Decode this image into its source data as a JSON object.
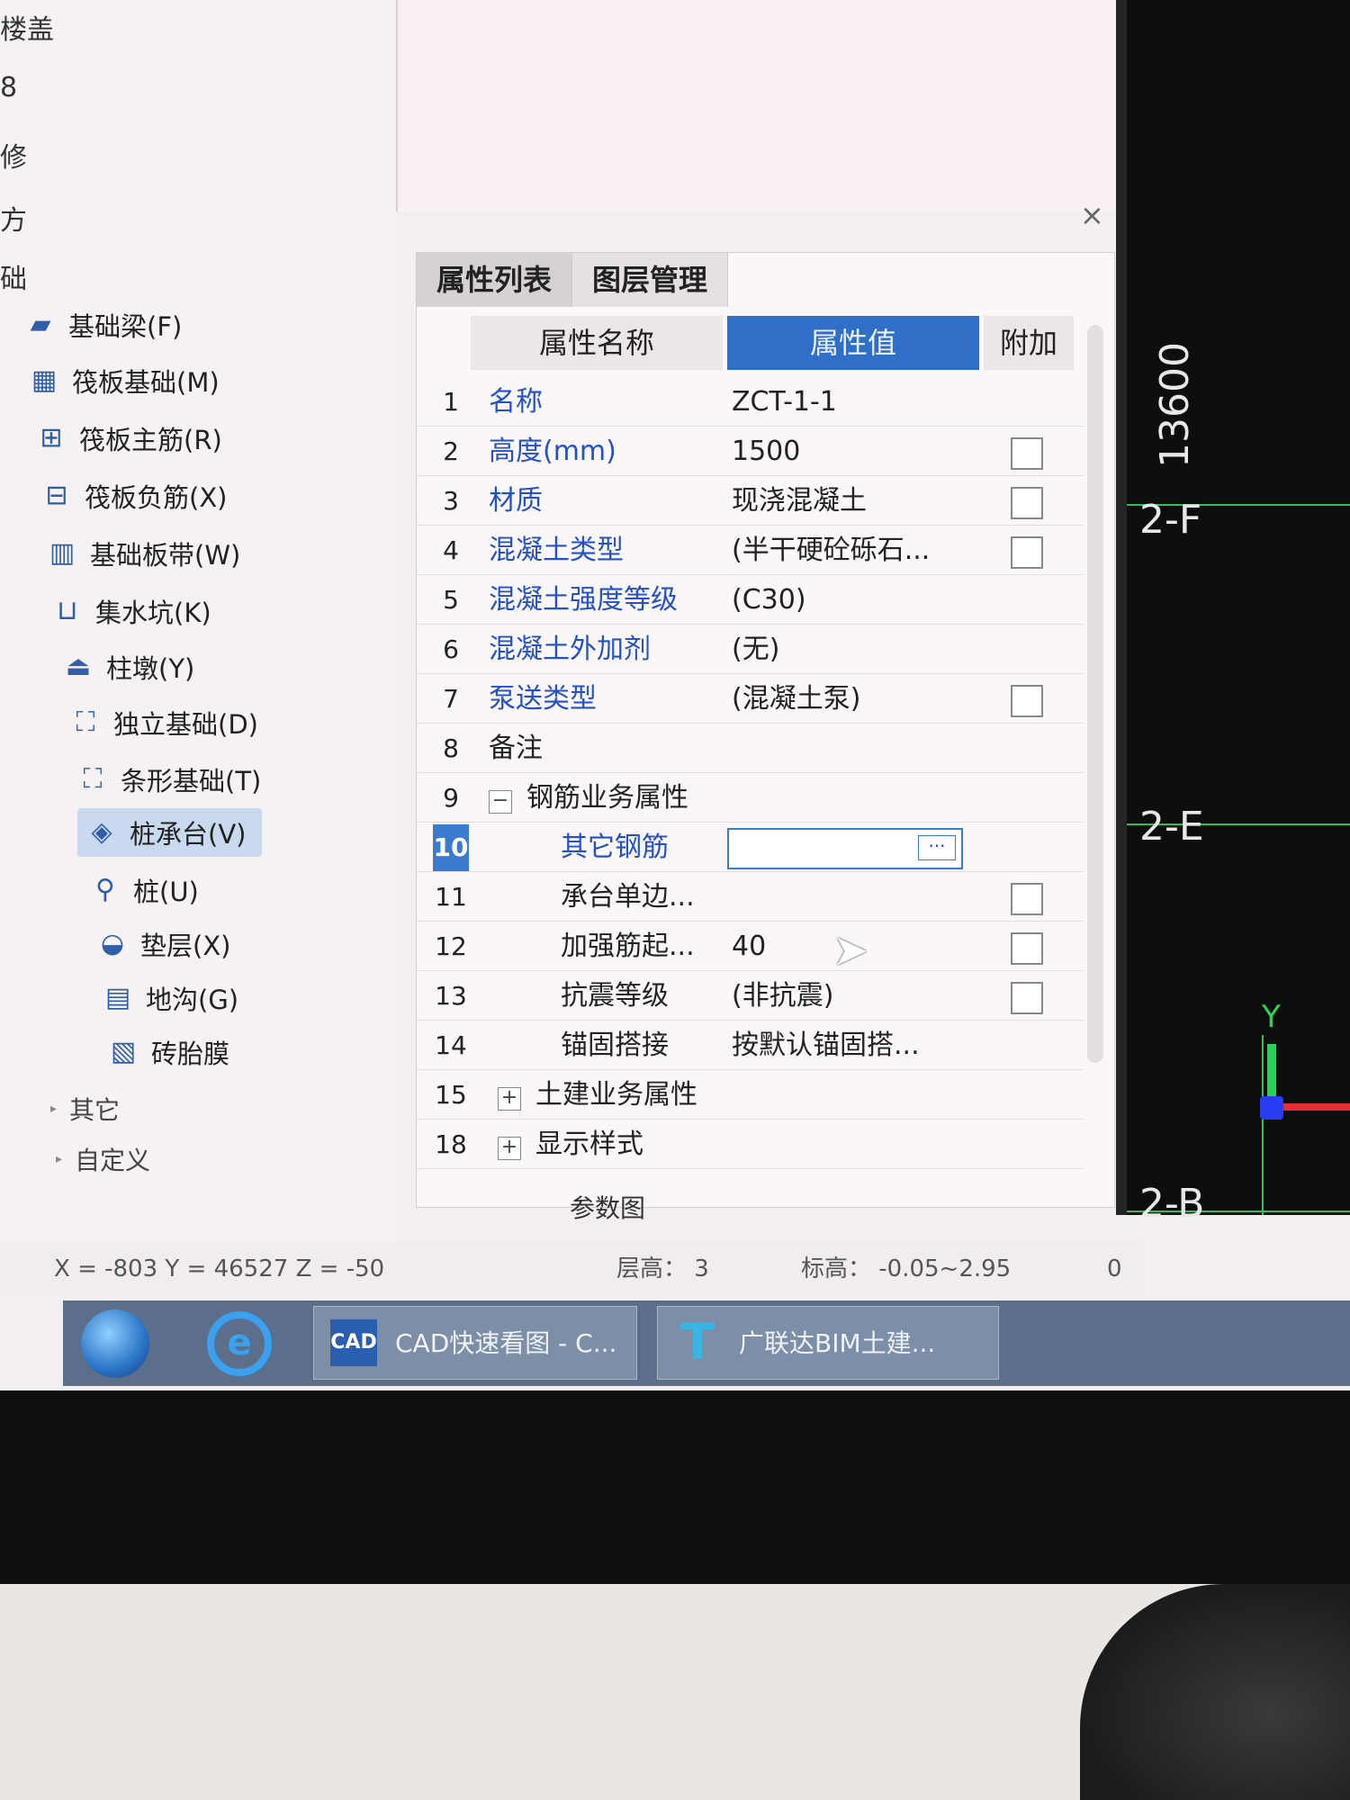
{
  "left_tree": {
    "cut_labels": [
      "楼盖",
      "8",
      "修",
      "方",
      "础"
    ],
    "items": [
      {
        "icon": "foundation-beam-icon",
        "glyph": "▰",
        "label": "基础梁(F)"
      },
      {
        "icon": "raft-foundation-icon",
        "glyph": "▦",
        "label": "筏板基础(M)"
      },
      {
        "icon": "raft-main-rebar-icon",
        "glyph": "⊞",
        "label": "筏板主筋(R)"
      },
      {
        "icon": "raft-negative-rebar-icon",
        "glyph": "⊟",
        "label": "筏板负筋(X)"
      },
      {
        "icon": "foundation-strip-icon",
        "glyph": "▥",
        "label": "基础板带(W)"
      },
      {
        "icon": "sump-pit-icon",
        "glyph": "⊔",
        "label": "集水坑(K)"
      },
      {
        "icon": "column-pier-icon",
        "glyph": "⏏",
        "label": "柱墩(Y)"
      },
      {
        "icon": "isolated-footing-icon",
        "glyph": "⛶",
        "label": "独立基础(D)"
      },
      {
        "icon": "strip-footing-icon",
        "glyph": "⛶",
        "label": "条形基础(T)"
      },
      {
        "icon": "pile-cap-icon",
        "glyph": "◈",
        "label": "桩承台(V)",
        "selected": true
      },
      {
        "icon": "pile-icon",
        "glyph": "⚲",
        "label": "桩(U)"
      },
      {
        "icon": "cushion-layer-icon",
        "glyph": "◒",
        "label": "垫层(X)"
      },
      {
        "icon": "trench-icon",
        "glyph": "▤",
        "label": "地沟(G)"
      },
      {
        "icon": "brick-mold-icon",
        "glyph": "▧",
        "label": "砖胎膜"
      }
    ],
    "groups": [
      "其它",
      "自定义"
    ]
  },
  "panel": {
    "tabs": [
      "属性列表",
      "图层管理"
    ],
    "headers": {
      "name": "属性名称",
      "value": "属性值",
      "extra": "附加"
    },
    "rows": [
      {
        "num": "1",
        "name": "名称",
        "value": "ZCT-1-1",
        "link": true,
        "check": false
      },
      {
        "num": "2",
        "name": "高度(mm)",
        "value": "1500",
        "link": true,
        "check": true
      },
      {
        "num": "3",
        "name": "材质",
        "value": "现浇混凝土",
        "link": true,
        "check": true
      },
      {
        "num": "4",
        "name": "混凝土类型",
        "value": "(半干硬砼砾石...",
        "link": true,
        "check": true
      },
      {
        "num": "5",
        "name": "混凝土强度等级",
        "value": "(C30)",
        "link": true,
        "check": false
      },
      {
        "num": "6",
        "name": "混凝土外加剂",
        "value": "(无)",
        "link": true,
        "check": false
      },
      {
        "num": "7",
        "name": "泵送类型",
        "value": "(混凝土泵)",
        "link": true,
        "check": true
      },
      {
        "num": "8",
        "name": "备注",
        "value": "",
        "link": false,
        "check": false
      },
      {
        "num": "9",
        "name": "钢筋业务属性",
        "value": "",
        "link": false,
        "check": false,
        "expander": "−"
      },
      {
        "num": "10",
        "name": "其它钢筋",
        "value": "",
        "link": true,
        "check": false,
        "selected": true,
        "sub": true
      },
      {
        "num": "11",
        "name": "承台单边...",
        "value": "",
        "link": false,
        "check": true,
        "sub": true
      },
      {
        "num": "12",
        "name": "加强筋起...",
        "value": "40",
        "link": false,
        "check": true,
        "sub": true
      },
      {
        "num": "13",
        "name": "抗震等级",
        "value": "(非抗震)",
        "link": false,
        "check": true,
        "sub": true
      },
      {
        "num": "14",
        "name": "锚固搭接",
        "value": "按默认锚固搭...",
        "link": false,
        "check": false,
        "sub": true
      },
      {
        "num": "15",
        "name": "土建业务属性",
        "value": "",
        "link": false,
        "check": false,
        "expander": "+"
      },
      {
        "num": "18",
        "name": "显示样式",
        "value": "",
        "link": false,
        "check": false,
        "expander": "+"
      }
    ],
    "edit_button_label": "···",
    "param_link": "参数图",
    "close_glyph": "×"
  },
  "cad": {
    "dimension": "13600",
    "axes": [
      "2-F",
      "2-E",
      "2-B"
    ],
    "axis_label_y": "Y"
  },
  "status": {
    "coords": "X = -803 Y = 46527 Z = -50",
    "floor_height": "层高： 3",
    "elevation": "标高： -0.05~2.95",
    "value": "0"
  },
  "taskbar": {
    "cad_app": "CAD快速看图 - C...",
    "cad_icon": "CAD",
    "bim_app": "广联达BIM土建...",
    "bim_icon": "T",
    "ie_glyph": "e"
  }
}
